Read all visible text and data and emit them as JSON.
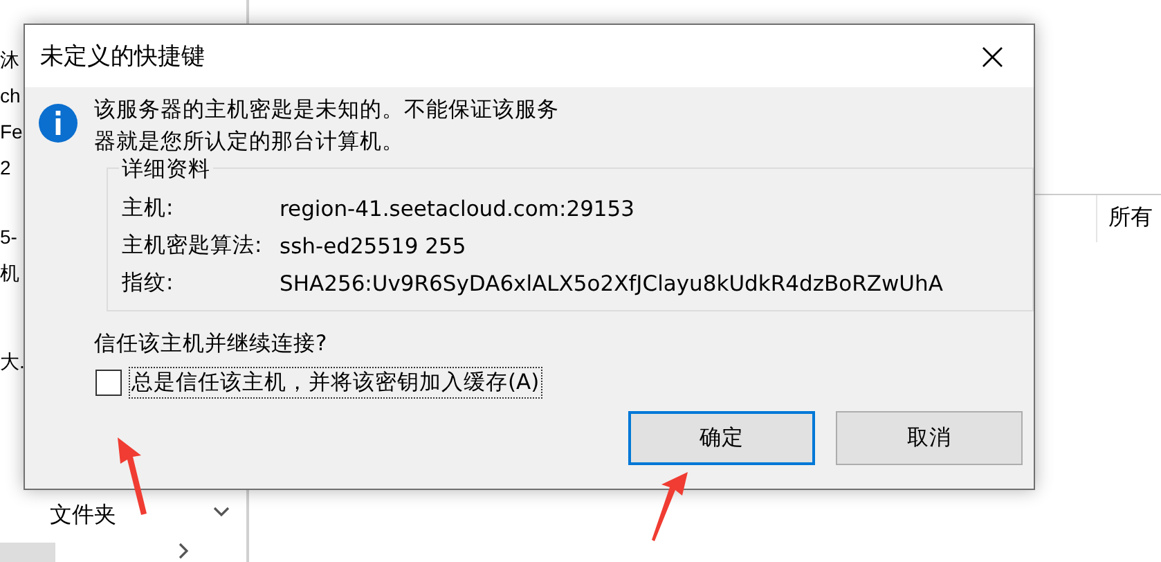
{
  "background": {
    "left_items": [
      "沐",
      "ch",
      "Fe",
      "2",
      "5-",
      "机",
      "大.",
      "文件夹"
    ],
    "columns": [
      "所有"
    ]
  },
  "dialog": {
    "title": "未定义的快捷键",
    "close": "×",
    "message": "该服务器的主机密匙是未知的。不能保证该服务器就是您所认定的那台计算机。",
    "details_title": "详细资料",
    "details": [
      {
        "label": "主机:",
        "value": "region-41.seetacloud.com:29153"
      },
      {
        "label": "主机密匙算法:",
        "value": "ssh-ed25519 255"
      },
      {
        "label": "指纹:",
        "value": "SHA256:Uv9R6SyDA6xlALX5o2XfJClayu8kUdkR4dzBoRZwUhA"
      }
    ],
    "question": "信任该主机并继续连接?",
    "checkbox": {
      "label": "总是信任该主机，并将该密钥加入缓存(A)",
      "checked": false
    },
    "buttons": [
      {
        "label": "确定",
        "selected": true
      },
      {
        "label": "取消",
        "selected": false
      }
    ]
  }
}
